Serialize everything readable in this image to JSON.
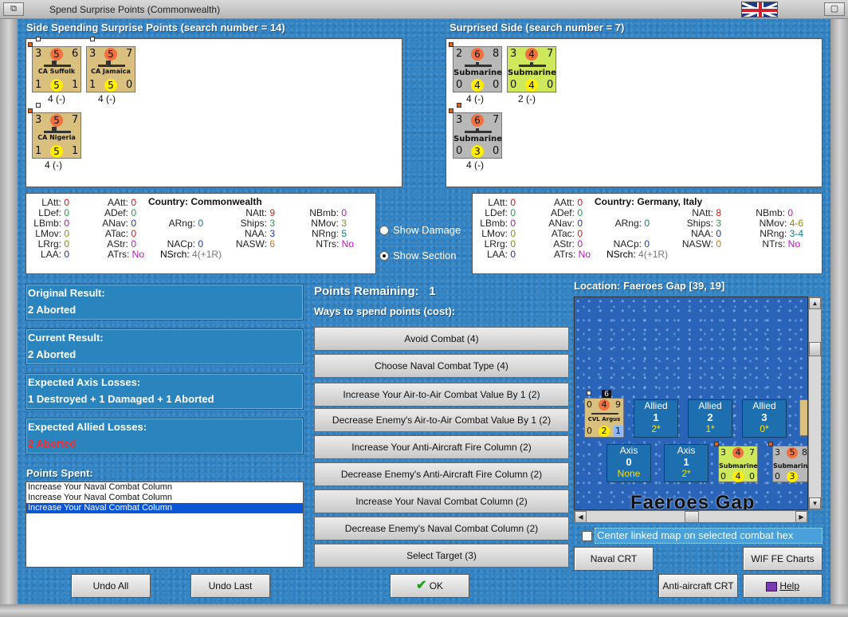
{
  "window": {
    "title": "Spend Surprise Points (Commonwealth)"
  },
  "spending": {
    "header": "Side Spending Surprise Points (search number = 14)",
    "units": [
      {
        "name": "CA Suffolk",
        "tl": "3",
        "tc": "5",
        "tr": "6",
        "bl": "1",
        "bc": "5",
        "br": "1",
        "loss": "4 (-)"
      },
      {
        "name": "CA Jamaica",
        "tl": "3",
        "tc": "5",
        "tr": "7",
        "bl": "1",
        "bc": "5",
        "br": "0",
        "loss": "4 (-)"
      },
      {
        "name": "CA Nigeria",
        "tl": "3",
        "tc": "5",
        "tr": "7",
        "bl": "1",
        "bc": "5",
        "br": "1",
        "loss": "4 (-)"
      }
    ]
  },
  "surprised": {
    "header": "Surprised Side (search number = 7)",
    "units": [
      {
        "name": "Submarine",
        "tl": "2",
        "tc": "6",
        "tr": "8",
        "bl": "0",
        "bc": "4",
        "br": "0",
        "loss": "4 (-)"
      },
      {
        "name": "Submarine",
        "tl": "3",
        "tc": "4",
        "tr": "7",
        "bl": "0",
        "bc": "4",
        "br": "0",
        "loss": "2 (-)"
      },
      {
        "name": "Submarine",
        "tl": "3",
        "tc": "6",
        "tr": "7",
        "bl": "0",
        "bc": "3",
        "br": "0",
        "loss": "4 (-)"
      }
    ]
  },
  "stats_left": {
    "country_label": "Country:",
    "country": "Commonwealth",
    "LAtt": "0",
    "LDef": "0",
    "LBmb": "0",
    "LMov": "0",
    "LRrg": "0",
    "LAA": "0",
    "AAtt": "0",
    "ADef": "0",
    "ANav": "0",
    "ATac": "0",
    "AStr": "0",
    "ATrs": "No",
    "ARng": "0",
    "NACp": "0",
    "NSrch": "4(+1R)",
    "NAtt": "9",
    "Ships": "3",
    "NAA": "3",
    "NASW": "6",
    "NBmb": "0",
    "NMov": "3",
    "NRng": "5",
    "NTrs": "No"
  },
  "stats_right": {
    "country_label": "Country:",
    "country": "Germany, Italy",
    "LAtt": "0",
    "LDef": "0",
    "LBmb": "0",
    "LMov": "0",
    "LRrg": "0",
    "LAA": "0",
    "AAtt": "0",
    "ADef": "0",
    "ANav": "0",
    "ATac": "0",
    "AStr": "0",
    "ATrs": "No",
    "ARng": "0",
    "NACp": "0",
    "NSrch": "4(+1R)",
    "NAtt": "8",
    "Ships": "3",
    "NAA": "0",
    "NASW": "0",
    "NBmb": "0",
    "NMov": "4-6",
    "NRng": "3-4",
    "NTrs": "No"
  },
  "labels": {
    "LAtt": "LAtt:",
    "LDef": "LDef:",
    "LBmb": "LBmb:",
    "LMov": "LMov:",
    "LRrg": "LRrg:",
    "LAA": "LAA:",
    "AAtt": "AAtt:",
    "ADef": "ADef:",
    "ANav": "ANav:",
    "ATac": "ATac:",
    "AStr": "AStr:",
    "ATrs": "ATrs:",
    "ARng": "ARng:",
    "NACp": "NACp:",
    "NSrch": "NSrch:",
    "NAtt": "NAtt:",
    "Ships": "Ships:",
    "NAA": "NAA:",
    "NASW": "NASW:",
    "NBmb": "NBmb:",
    "NMov": "NMov:",
    "NRng": "NRng:",
    "NTrs": "NTrs:"
  },
  "view": {
    "show_damage": "Show Damage",
    "show_section": "Show Section"
  },
  "results": {
    "original_label": "Original Result:",
    "original": "2 Aborted",
    "current_label": "Current Result:",
    "current": "2 Aborted",
    "axis_label": "Expected Axis Losses:",
    "axis": "1 Destroyed + 1 Damaged + 1 Aborted",
    "allied_label": "Expected Allied Losses:",
    "allied": "2 Aborted"
  },
  "points": {
    "spent_label": "Points Spent:",
    "spent": [
      "Increase Your Naval Combat Column",
      "Increase Your Naval Combat Column",
      "Increase Your Naval Combat Column"
    ],
    "remaining_label": "Points Remaining:",
    "remaining": "1",
    "ways_label": "Ways to spend points (cost):",
    "options": [
      "Avoid Combat (4)",
      "Choose Naval Combat Type (4)",
      "Increase Your Air-to-Air Combat Value By 1 (2)",
      "Decrease Enemy's Air-to-Air Combat Value By 1 (2)",
      "Increase Your Anti-Aircraft Fire Column (2)",
      "Decrease Enemy's Anti-Aircraft Fire Column (2)",
      "Increase Your Naval Combat Column (2)",
      "Decrease Enemy's Naval Combat Column (2)",
      "Select Target (3)"
    ]
  },
  "location": {
    "label": "Location: Faeroes Gap [39, 19]",
    "map_name": "Faeroes Gap",
    "stack_count": "6",
    "map_unit": {
      "name": "CVL Argus",
      "tl": "0",
      "tc": "4",
      "tr": "9",
      "bl": "0",
      "bc": "2",
      "br": "1"
    },
    "map_sub1": {
      "name": "Submarine",
      "tl": "3",
      "tc": "4",
      "tr": "7",
      "bl": "0",
      "bc": "4",
      "br": "0"
    },
    "map_sub2": {
      "name": "Submarine",
      "tl": "3",
      "tc": "5",
      "tr": "8",
      "bl": "0",
      "bc": "3",
      "br": ""
    },
    "boxes": [
      {
        "side": "Allied",
        "num": "1",
        "val": "2*"
      },
      {
        "side": "Allied",
        "num": "2",
        "val": "1*"
      },
      {
        "side": "Allied",
        "num": "3",
        "val": "0*"
      },
      {
        "side": "Axis",
        "num": "0",
        "val": "None"
      },
      {
        "side": "Axis",
        "num": "1",
        "val": "2*"
      }
    ],
    "center_label": "Center linked map on selected combat hex"
  },
  "buttons": {
    "undo_all": "Undo All",
    "undo_last": "Undo Last",
    "ok": "OK",
    "naval_crt": "Naval CRT",
    "wif_charts": "WIF FE Charts",
    "aa_crt": "Anti-aircraft CRT",
    "help": "Help"
  }
}
